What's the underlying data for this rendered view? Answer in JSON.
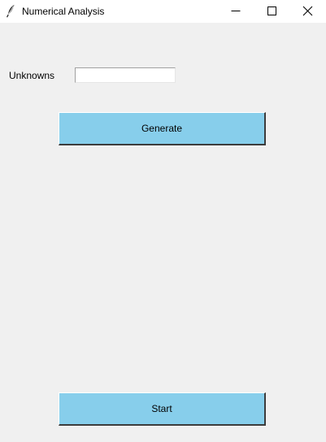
{
  "window": {
    "title": "Numerical Analysis",
    "icon": "feather-icon",
    "controls": [
      "minimize-icon",
      "maximize-icon",
      "close-icon"
    ]
  },
  "form": {
    "unknowns_label": "Unknowns",
    "unknowns_value": "",
    "generate_label": "Generate",
    "start_label": "Start"
  },
  "colors": {
    "background": "#f0f0f0",
    "titlebar": "#ffffff",
    "button": "#87ceeb"
  }
}
